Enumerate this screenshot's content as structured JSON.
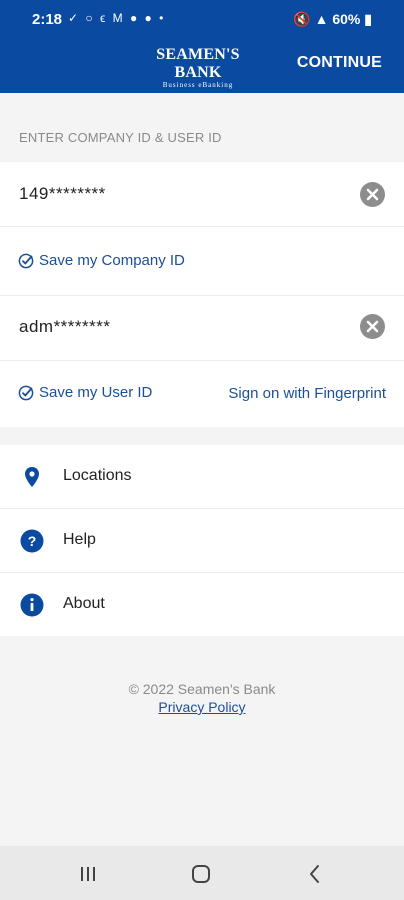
{
  "status_bar": {
    "time": "2:18",
    "left_icons": "✓ ○ ϵ M ● ● •",
    "battery": "60%"
  },
  "header": {
    "logo_main": "SEAMEN'S BANK",
    "logo_sub": "Business eBanking",
    "continue_label": "CONTINUE",
    "background_color": "#0a4aa0"
  },
  "login": {
    "section_label": "ENTER COMPANY ID & USER ID",
    "company_id_value": "149********",
    "save_company_label": "Save my Company ID",
    "user_id_value": "adm********",
    "save_user_label": "Save my User ID",
    "fingerprint_label": "Sign on with Fingerprint",
    "link_color": "#1b4f98"
  },
  "menu": {
    "items": [
      {
        "label": "Locations",
        "icon": "location-pin-icon"
      },
      {
        "label": "Help",
        "icon": "question-icon"
      },
      {
        "label": "About",
        "icon": "info-icon"
      }
    ]
  },
  "footer": {
    "copyright": "© 2022 Seamen's Bank",
    "privacy_label": "Privacy Policy"
  },
  "nav_bar": {
    "buttons": [
      "recent-apps-icon",
      "home-icon",
      "back-icon"
    ]
  }
}
